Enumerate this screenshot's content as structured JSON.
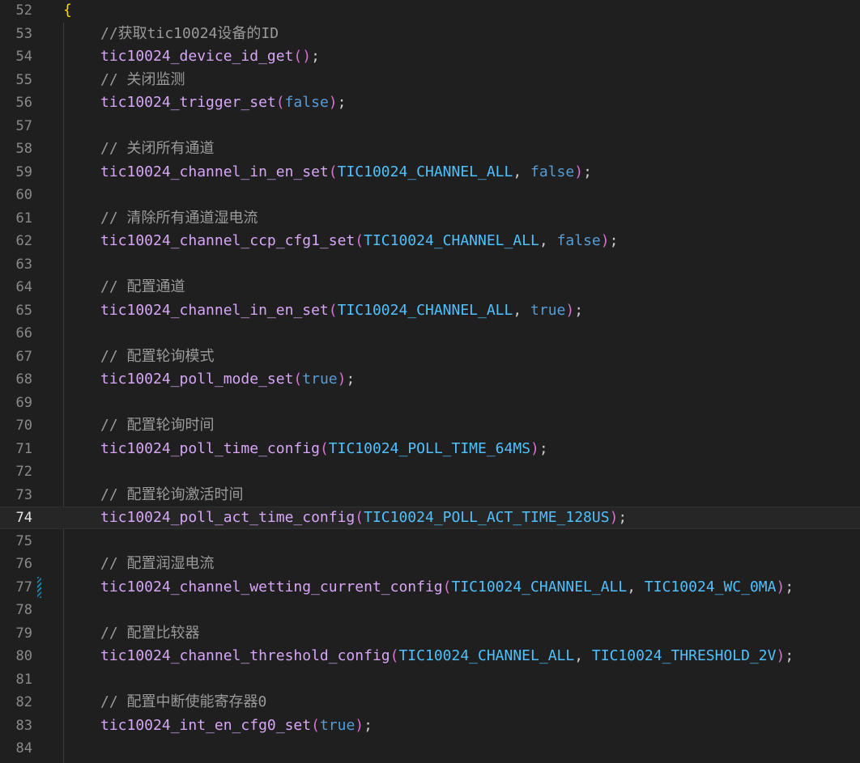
{
  "editor": {
    "lines": [
      {
        "num": "52",
        "tokens": [
          {
            "t": "{",
            "c": "c-brace"
          }
        ],
        "indent": false
      },
      {
        "num": "53",
        "tokens": [
          {
            "t": "//获取tic10024设备的ID",
            "c": "c-comment"
          }
        ],
        "indent": true
      },
      {
        "num": "54",
        "tokens": [
          {
            "t": "tic10024_device_id_get",
            "c": "c-fn"
          },
          {
            "t": "()",
            "c": "c-paren"
          },
          {
            "t": ";",
            "c": "c-punct"
          }
        ],
        "indent": true
      },
      {
        "num": "55",
        "tokens": [
          {
            "t": "// 关闭监测",
            "c": "c-comment"
          }
        ],
        "indent": true
      },
      {
        "num": "56",
        "tokens": [
          {
            "t": "tic10024_trigger_set",
            "c": "c-fn"
          },
          {
            "t": "(",
            "c": "c-paren"
          },
          {
            "t": "false",
            "c": "c-kw"
          },
          {
            "t": ")",
            "c": "c-paren"
          },
          {
            "t": ";",
            "c": "c-punct"
          }
        ],
        "indent": true
      },
      {
        "num": "57",
        "tokens": [],
        "indent": true
      },
      {
        "num": "58",
        "tokens": [
          {
            "t": "// 关闭所有通道",
            "c": "c-comment"
          }
        ],
        "indent": true
      },
      {
        "num": "59",
        "tokens": [
          {
            "t": "tic10024_channel_in_en_set",
            "c": "c-fn"
          },
          {
            "t": "(",
            "c": "c-paren"
          },
          {
            "t": "TIC10024_CHANNEL_ALL",
            "c": "c-const"
          },
          {
            "t": ", ",
            "c": "c-punct"
          },
          {
            "t": "false",
            "c": "c-kw"
          },
          {
            "t": ")",
            "c": "c-paren"
          },
          {
            "t": ";",
            "c": "c-punct"
          }
        ],
        "indent": true
      },
      {
        "num": "60",
        "tokens": [],
        "indent": true
      },
      {
        "num": "61",
        "tokens": [
          {
            "t": "// 清除所有通道湿电流",
            "c": "c-comment"
          }
        ],
        "indent": true
      },
      {
        "num": "62",
        "tokens": [
          {
            "t": "tic10024_channel_ccp_cfg1_set",
            "c": "c-fn"
          },
          {
            "t": "(",
            "c": "c-paren"
          },
          {
            "t": "TIC10024_CHANNEL_ALL",
            "c": "c-const"
          },
          {
            "t": ", ",
            "c": "c-punct"
          },
          {
            "t": "false",
            "c": "c-kw"
          },
          {
            "t": ")",
            "c": "c-paren"
          },
          {
            "t": ";",
            "c": "c-punct"
          }
        ],
        "indent": true
      },
      {
        "num": "63",
        "tokens": [],
        "indent": true
      },
      {
        "num": "64",
        "tokens": [
          {
            "t": "// 配置通道",
            "c": "c-comment"
          }
        ],
        "indent": true
      },
      {
        "num": "65",
        "tokens": [
          {
            "t": "tic10024_channel_in_en_set",
            "c": "c-fn"
          },
          {
            "t": "(",
            "c": "c-paren"
          },
          {
            "t": "TIC10024_CHANNEL_ALL",
            "c": "c-const"
          },
          {
            "t": ", ",
            "c": "c-punct"
          },
          {
            "t": "true",
            "c": "c-kw"
          },
          {
            "t": ")",
            "c": "c-paren"
          },
          {
            "t": ";",
            "c": "c-punct"
          }
        ],
        "indent": true
      },
      {
        "num": "66",
        "tokens": [],
        "indent": true
      },
      {
        "num": "67",
        "tokens": [
          {
            "t": "// 配置轮询模式",
            "c": "c-comment"
          }
        ],
        "indent": true
      },
      {
        "num": "68",
        "tokens": [
          {
            "t": "tic10024_poll_mode_set",
            "c": "c-fn"
          },
          {
            "t": "(",
            "c": "c-paren"
          },
          {
            "t": "true",
            "c": "c-kw"
          },
          {
            "t": ")",
            "c": "c-paren"
          },
          {
            "t": ";",
            "c": "c-punct"
          }
        ],
        "indent": true
      },
      {
        "num": "69",
        "tokens": [],
        "indent": true
      },
      {
        "num": "70",
        "tokens": [
          {
            "t": "// 配置轮询时间",
            "c": "c-comment"
          }
        ],
        "indent": true
      },
      {
        "num": "71",
        "tokens": [
          {
            "t": "tic10024_poll_time_config",
            "c": "c-fn"
          },
          {
            "t": "(",
            "c": "c-paren"
          },
          {
            "t": "TIC10024_POLL_TIME_64MS",
            "c": "c-const"
          },
          {
            "t": ")",
            "c": "c-paren"
          },
          {
            "t": ";",
            "c": "c-punct"
          }
        ],
        "indent": true
      },
      {
        "num": "72",
        "tokens": [],
        "indent": true
      },
      {
        "num": "73",
        "tokens": [
          {
            "t": "// 配置轮询激活时间",
            "c": "c-comment"
          }
        ],
        "indent": true
      },
      {
        "num": "74",
        "tokens": [
          {
            "t": "tic10024_poll_act_time_config",
            "c": "c-fn"
          },
          {
            "t": "(",
            "c": "c-paren"
          },
          {
            "t": "TIC10024_POLL_ACT_TIME_128US",
            "c": "c-const"
          },
          {
            "t": ")",
            "c": "c-paren"
          },
          {
            "t": ";",
            "c": "c-punct"
          }
        ],
        "indent": true,
        "current": true
      },
      {
        "num": "75",
        "tokens": [],
        "indent": true
      },
      {
        "num": "76",
        "tokens": [
          {
            "t": "// 配置润湿电流",
            "c": "c-comment"
          }
        ],
        "indent": true
      },
      {
        "num": "77",
        "tokens": [
          {
            "t": "tic10024_channel_wetting_current_config",
            "c": "c-fn"
          },
          {
            "t": "(",
            "c": "c-paren"
          },
          {
            "t": "TIC10024_CHANNEL_ALL",
            "c": "c-const"
          },
          {
            "t": ", ",
            "c": "c-punct"
          },
          {
            "t": "TIC10024_WC_0MA",
            "c": "c-const"
          },
          {
            "t": ")",
            "c": "c-paren"
          },
          {
            "t": ";",
            "c": "c-punct"
          }
        ],
        "indent": true,
        "modified": true
      },
      {
        "num": "78",
        "tokens": [],
        "indent": true
      },
      {
        "num": "79",
        "tokens": [
          {
            "t": "// 配置比较器",
            "c": "c-comment"
          }
        ],
        "indent": true
      },
      {
        "num": "80",
        "tokens": [
          {
            "t": "tic10024_channel_threshold_config",
            "c": "c-fn"
          },
          {
            "t": "(",
            "c": "c-paren"
          },
          {
            "t": "TIC10024_CHANNEL_ALL",
            "c": "c-const"
          },
          {
            "t": ", ",
            "c": "c-punct"
          },
          {
            "t": "TIC10024_THRESHOLD_2V",
            "c": "c-const"
          },
          {
            "t": ")",
            "c": "c-paren"
          },
          {
            "t": ";",
            "c": "c-punct"
          }
        ],
        "indent": true
      },
      {
        "num": "81",
        "tokens": [],
        "indent": true
      },
      {
        "num": "82",
        "tokens": [
          {
            "t": "// 配置中断使能寄存器0",
            "c": "c-comment"
          }
        ],
        "indent": true
      },
      {
        "num": "83",
        "tokens": [
          {
            "t": "tic10024_int_en_cfg0_set",
            "c": "c-fn"
          },
          {
            "t": "(",
            "c": "c-paren"
          },
          {
            "t": "true",
            "c": "c-kw"
          },
          {
            "t": ")",
            "c": "c-paren"
          },
          {
            "t": ";",
            "c": "c-punct"
          }
        ],
        "indent": true
      },
      {
        "num": "84",
        "tokens": [],
        "indent": true
      }
    ]
  },
  "colors": {
    "background": "#1f1f1f",
    "line_number": "#8a8a8a",
    "comment": "#9a9a9a",
    "function": "#d7a6f7",
    "constant": "#4fc1ff",
    "keyword": "#569cd6",
    "paren": "#da70d6",
    "brace": "#ffd700"
  }
}
